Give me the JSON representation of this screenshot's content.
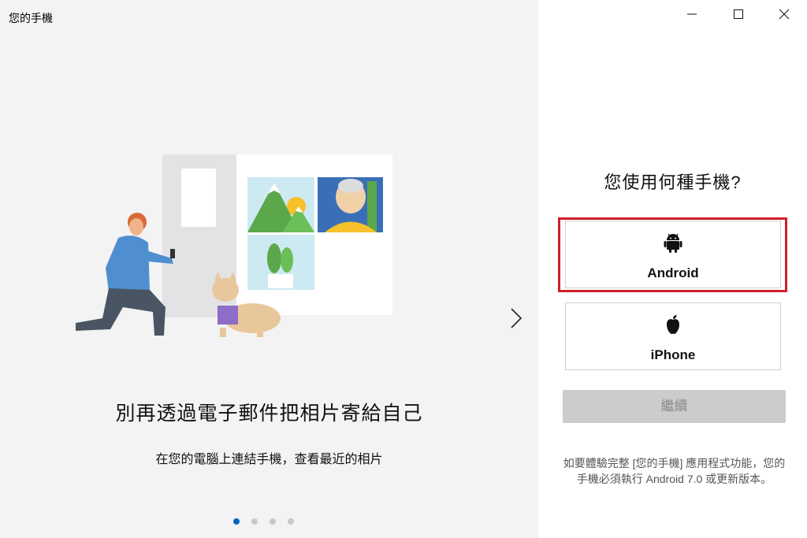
{
  "window": {
    "title": "您的手機"
  },
  "carousel": {
    "headline": "別再透過電子郵件把相片寄給自己",
    "subline": "在您的電腦上連結手機，查看最近的相片",
    "page_index": 1,
    "page_count": 4
  },
  "setup": {
    "question": "您使用何種手機?",
    "options": [
      {
        "label": "Android",
        "icon": "android-icon"
      },
      {
        "label": "iPhone",
        "icon": "apple-icon"
      }
    ],
    "continue_label": "繼續",
    "note": "如要體驗完整 [您的手機] 應用程式功能，您的手機必須執行 Android 7.0 或更新版本。"
  },
  "colors": {
    "left_bg": "#f3f3f3",
    "highlight": "#d0202a",
    "active_dot": "#0067c0",
    "disabled_button": "#cccccc"
  }
}
